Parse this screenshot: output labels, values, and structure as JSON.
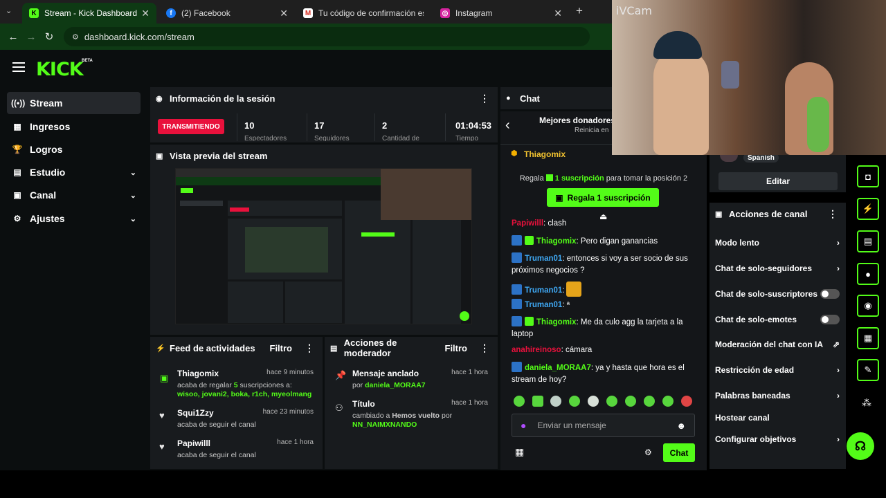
{
  "browser": {
    "tabs": [
      {
        "title": "Stream - Kick Dashboard",
        "active": true
      },
      {
        "title": "(2) Facebook"
      },
      {
        "title": "Tu código de confirmación es !"
      },
      {
        "title": "Instagram"
      }
    ],
    "url": "dashboard.kick.com/stream"
  },
  "app": {
    "logo": "KICK",
    "beta": "BETA"
  },
  "sidebar": {
    "items": [
      {
        "label": "Stream",
        "icon": "broadcast-icon"
      },
      {
        "label": "Ingresos",
        "icon": "chart-icon"
      },
      {
        "label": "Logros",
        "icon": "trophy-icon"
      },
      {
        "label": "Estudio",
        "icon": "layout-icon"
      },
      {
        "label": "Canal",
        "icon": "channel-icon"
      },
      {
        "label": "Ajustes",
        "icon": "gear-icon"
      }
    ]
  },
  "session": {
    "title": "Información de la sesión",
    "live_label": "TRANSMITIENDO",
    "stats": [
      {
        "value": "10",
        "sub": "Espectadores"
      },
      {
        "value": "17",
        "sub": "Seguidores"
      },
      {
        "value": "2",
        "sub": "Cantidad de"
      },
      {
        "value": "01:04:53",
        "sub": "Tiempo"
      }
    ]
  },
  "preview": {
    "title": "Vista previa del stream"
  },
  "activity": {
    "title": "Feed de actividades",
    "filter": "Filtro",
    "items": [
      {
        "user": "Thiagomix",
        "time": "hace 9 minutos",
        "text": "acaba de regalar ",
        "count": "5",
        "text2": " suscripciones a:",
        "names": "wisoo, jovani2, boka, r1ch, myeolmang"
      },
      {
        "user": "Squi1Zzy",
        "time": "hace 23 minutos",
        "text": "acaba de seguir el canal"
      },
      {
        "user": "Papiwilll",
        "time": "hace 1 hora",
        "text": "acaba de seguir el canal"
      }
    ]
  },
  "moderator": {
    "title": "Acciones de moderador",
    "filter": "Filtro",
    "items": [
      {
        "title": "Mensaje anclado",
        "time": "hace 1 hora",
        "by": "por ",
        "user": "daniela_MORAA7"
      },
      {
        "title": "Título",
        "time": "hace 1 hora",
        "text": "cambiado a ",
        "bold": "Hemos vuelto",
        "by": " por",
        "user": "NN_NAIMXNANDO"
      }
    ]
  },
  "chat": {
    "title": "Chat",
    "top_title": "Mejores donadores",
    "top_sub": "Reinicia en",
    "top_user": "Thiagomix",
    "gift_prefix": "Regala ",
    "gift_sub": "1 suscripción",
    "gift_suffix": " para tomar la posición 2",
    "gift_button": "Regala 1 suscripción",
    "partial_user": "Papiwilll",
    "partial_text": ": clash",
    "messages": [
      {
        "user": "Thiagomix",
        "text": ": Pero digan ganancias",
        "color": "#53fc18"
      },
      {
        "user": "Truman01",
        "text": ": entonces si voy a ser socio de sus próximos negocios ?",
        "color": "#3fa9f5"
      },
      {
        "user": "Truman01",
        "text": ":",
        "color": "#3fa9f5"
      },
      {
        "user": "Truman01",
        "text": ": ª",
        "color": "#3fa9f5"
      },
      {
        "user": "Thiagomix",
        "text": ": Me da culo agg la tarjeta a la laptop",
        "color": "#53fc18"
      },
      {
        "user": "anahireinoso",
        "text": ": cámara",
        "color": "#e9113c"
      },
      {
        "user": "daniela_MORAA7",
        "text": ": ya y hasta que hora es el stream de hoy?",
        "color": "#53fc18"
      }
    ],
    "input_placeholder": "Enviar un mensaje",
    "send_label": "Chat"
  },
  "right": {
    "language": "Spanish",
    "edit": "Editar",
    "actions_title": "Acciones de canal",
    "items": [
      {
        "label": "Modo lento",
        "kind": "chevron"
      },
      {
        "label": "Chat de solo-seguidores",
        "kind": "chevron"
      },
      {
        "label": "Chat de solo-suscriptores",
        "kind": "toggle"
      },
      {
        "label": "Chat de solo-emotes",
        "kind": "toggle"
      },
      {
        "label": "Moderación del chat con IA",
        "kind": "external"
      },
      {
        "label": "Restricción de edad",
        "kind": "chevron"
      },
      {
        "label": "Palabras baneadas",
        "kind": "chevron"
      },
      {
        "label": "Hostear canal",
        "kind": "none"
      },
      {
        "label": "Configurar objetivos",
        "kind": "chevron"
      }
    ]
  },
  "webcam": {
    "overlay": "iVCam"
  },
  "colors": {
    "accent": "#53fc18",
    "live": "#e9113c",
    "link": "#3fa9f5"
  }
}
